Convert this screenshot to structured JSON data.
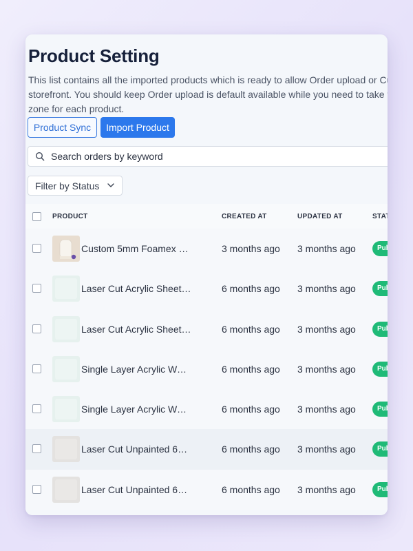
{
  "page": {
    "title": "Product Setting",
    "description": "This list contains all the imported products which is ready to allow Order upload or Custo storefront. You should keep Order upload is default available while you need to take time zone for each product."
  },
  "buttons": {
    "product_sync": "Product Sync",
    "import_product": "Import Product"
  },
  "search": {
    "placeholder": "Search orders by keyword",
    "icon": "search-icon"
  },
  "filter": {
    "label": "Filter by Status",
    "icon": "chevron-down-icon"
  },
  "table": {
    "headers": {
      "product": "PRODUCT",
      "created_at": "CREATED AT",
      "updated_at": "UPDATED AT",
      "status": "STATUS"
    },
    "rows": [
      {
        "name": "Custom 5mm Foamex Pr...",
        "created": "3 months ago",
        "updated": "3 months ago",
        "status": "Published",
        "thumb": "foamex"
      },
      {
        "name": "Laser Cut Acrylic Sheet ...",
        "created": "6 months ago",
        "updated": "3 months ago",
        "status": "Published",
        "thumb": "clear"
      },
      {
        "name": "Laser Cut Acrylic Sheet ...",
        "created": "6 months ago",
        "updated": "3 months ago",
        "status": "Published",
        "thumb": "clear"
      },
      {
        "name": "Single Layer Acrylic Wor...",
        "created": "6 months ago",
        "updated": "3 months ago",
        "status": "Published",
        "thumb": "clear"
      },
      {
        "name": "Single Layer Acrylic Wor...",
        "created": "6 months ago",
        "updated": "3 months ago",
        "status": "Published",
        "thumb": "clear"
      },
      {
        "name": "Laser Cut Unpainted 6m...",
        "created": "6 months ago",
        "updated": "3 months ago",
        "status": "Published",
        "thumb": "grey"
      },
      {
        "name": "Laser Cut Unpainted 6m...",
        "created": "6 months ago",
        "updated": "3 months ago",
        "status": "Published",
        "thumb": "grey"
      }
    ]
  },
  "colors": {
    "primary": "#2c78ec",
    "status_published": "#1fba77",
    "title": "#16203a"
  }
}
